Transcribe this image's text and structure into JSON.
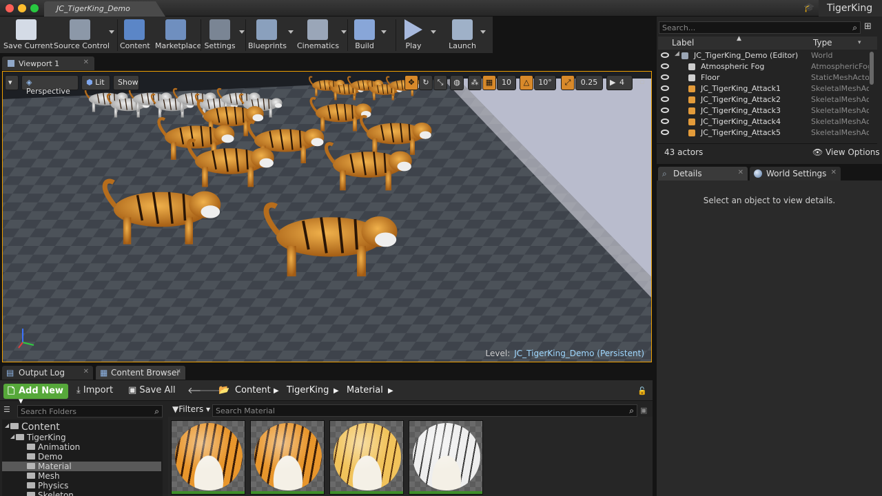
{
  "window": {
    "doc_tab": "JC_TigerKing_Demo",
    "project": "TigerKing"
  },
  "toolbar": [
    {
      "name": "save-current-button",
      "icon": "save-icon",
      "label": "Save Current",
      "color": "#d4dbe6",
      "arrow": false
    },
    {
      "name": "source-control-button",
      "icon": "source-control-icon",
      "label": "Source Control",
      "color": "#8c98a8",
      "arrow": true
    },
    {
      "name": "content-button",
      "icon": "content-icon",
      "label": "Content",
      "color": "#5b86c7",
      "arrow": false
    },
    {
      "name": "marketplace-button",
      "icon": "marketplace-icon",
      "label": "Marketplace",
      "color": "#6f8fbf",
      "arrow": false
    },
    {
      "name": "settings-button",
      "icon": "settings-icon",
      "label": "Settings",
      "color": "#7a8594",
      "arrow": true
    },
    {
      "name": "blueprints-button",
      "icon": "blueprints-icon",
      "label": "Blueprints",
      "color": "#8aa0bd",
      "arrow": true
    },
    {
      "name": "cinematics-button",
      "icon": "cinematics-icon",
      "label": "Cinematics",
      "color": "#9aa6b8",
      "arrow": true
    },
    {
      "name": "build-button",
      "icon": "build-icon",
      "label": "Build",
      "color": "#88a6d8",
      "arrow": true
    },
    {
      "name": "play-button",
      "icon": "play-icon",
      "label": "Play",
      "color": "#a7b9dd",
      "arrow": true
    },
    {
      "name": "launch-button",
      "icon": "launch-icon",
      "label": "Launch",
      "color": "#9fb1c8",
      "arrow": true
    }
  ],
  "viewport": {
    "tab": "Viewport 1",
    "buttons": {
      "perspective": "Perspective",
      "lit": "Lit",
      "show": "Show"
    },
    "tools": {
      "grid_snap": "10",
      "rotation_snap": "10°",
      "scale_snap": "0.25",
      "camera_speed": "4"
    },
    "level_label": "Level:",
    "level_name": "JC_TigerKing_Demo (Persistent)"
  },
  "outliner": {
    "search_placeholder": "Search...",
    "col_label": "Label",
    "col_type": "Type",
    "rows": [
      {
        "label": "JC_TigerKing_Demo (Editor)",
        "type": "World",
        "icon": "world-icon",
        "indent": 0,
        "expand": true
      },
      {
        "label": "Atmospheric Fog",
        "type": "AtmosphericFog",
        "icon": "fog-icon",
        "indent": 1,
        "expand": false
      },
      {
        "label": "Floor",
        "type": "StaticMeshActor",
        "icon": "static-mesh-icon",
        "indent": 1,
        "expand": false
      },
      {
        "label": "JC_TigerKing_Attack1",
        "type": "SkeletalMeshActor",
        "icon": "skeletal-mesh-icon",
        "indent": 1,
        "expand": false
      },
      {
        "label": "JC_TigerKing_Attack2",
        "type": "SkeletalMeshActor",
        "icon": "skeletal-mesh-icon",
        "indent": 1,
        "expand": false
      },
      {
        "label": "JC_TigerKing_Attack3",
        "type": "SkeletalMeshActor",
        "icon": "skeletal-mesh-icon",
        "indent": 1,
        "expand": false
      },
      {
        "label": "JC_TigerKing_Attack4",
        "type": "SkeletalMeshActor",
        "icon": "skeletal-mesh-icon",
        "indent": 1,
        "expand": false
      },
      {
        "label": "JC_TigerKing_Attack5",
        "type": "SkeletalMeshActor",
        "icon": "skeletal-mesh-icon",
        "indent": 1,
        "expand": false
      }
    ],
    "actor_count": "43 actors",
    "view_options": "View Options"
  },
  "details": {
    "tab_details": "Details",
    "tab_world_settings": "World Settings",
    "empty_message": "Select an object to view details."
  },
  "bottom_tabs": {
    "output_log": "Output Log",
    "content_browser": "Content Browser"
  },
  "content_browser": {
    "add_new": "Add New",
    "import": "Import",
    "save_all": "Save All",
    "path": [
      "Content",
      "TigerKing",
      "Material"
    ],
    "folder_search_placeholder": "Search Folders",
    "filters": "Filters",
    "asset_search_placeholder": "Search Material",
    "tree": [
      {
        "label": "Content",
        "level": 0
      },
      {
        "label": "TigerKing",
        "level": 1
      },
      {
        "label": "Animation",
        "level": 2
      },
      {
        "label": "Demo",
        "level": 2
      },
      {
        "label": "Material",
        "level": 2,
        "selected": true
      },
      {
        "label": "Mesh",
        "level": 2
      },
      {
        "label": "Physics",
        "level": 2
      },
      {
        "label": "Skeleton",
        "level": 2
      }
    ],
    "materials": [
      {
        "palette": "orange"
      },
      {
        "palette": "orange"
      },
      {
        "palette": "golden"
      },
      {
        "palette": "white"
      }
    ]
  },
  "colors": {
    "accent": "#f0a000",
    "add_new_green": "#56a83a",
    "level_name": "#9fd8ff"
  }
}
